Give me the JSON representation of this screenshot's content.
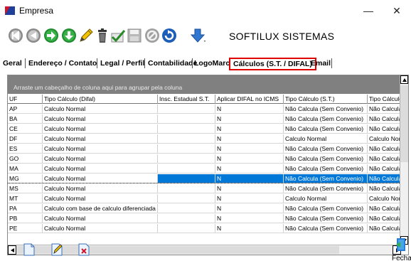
{
  "window": {
    "title": "Empresa",
    "minimize": "—",
    "close": "✕"
  },
  "toolbar": {
    "brand": "SOFTILUX SISTEMAS",
    "icons": [
      "first-record-icon",
      "previous-record-icon",
      "next-record-icon",
      "last-record-icon",
      "edit-icon",
      "delete-icon",
      "confirm-icon",
      "save-icon",
      "cancel-icon",
      "refresh-icon",
      "dropdown-arrow-icon"
    ]
  },
  "tabs": [
    "Geral",
    "Endereço / Contato",
    "Legal / Perfil",
    "Contabilidade",
    "LogoMarca",
    "Cálculos (S.T. / DIFAL)",
    "Email"
  ],
  "grid": {
    "group_hint": "Arraste um cabeçalho de coluna aqui para agrupar pela coluna",
    "columns": [
      "UF",
      "Tipo Cálculo (Difal)",
      "Insc. Estadual S.T.",
      "Aplicar DIFAL no ICMS",
      "Tipo Cálculo (S.T.)",
      "Tipo Cálculo"
    ],
    "rows": [
      [
        "AP",
        "Calculo Normal",
        "",
        "N",
        "Não Calcula (Sem Convenio)",
        "Não Calcula"
      ],
      [
        "BA",
        "Calculo Normal",
        "",
        "N",
        "Não Calcula (Sem Convenio)",
        "Não Calcula"
      ],
      [
        "CE",
        "Calculo Normal",
        "",
        "N",
        "Não Calcula (Sem Convenio)",
        "Não Calcula"
      ],
      [
        "DF",
        "Calculo Normal",
        "",
        "N",
        "Calculo Normal",
        "Calculo Norm"
      ],
      [
        "ES",
        "Calculo Normal",
        "",
        "N",
        "Não Calcula (Sem Convenio)",
        "Não Calcula"
      ],
      [
        "GO",
        "Calculo Normal",
        "",
        "N",
        "Não Calcula (Sem Convenio)",
        "Não Calcula"
      ],
      [
        "MA",
        "Calculo Normal",
        "",
        "N",
        "Não Calcula (Sem Convenio)",
        "Não Calcula"
      ],
      [
        "MG",
        "Calculo Normal",
        "",
        "N",
        "Não Calcula (Sem Convenio)",
        "Não Calcula"
      ],
      [
        "MS",
        "Calculo Normal",
        "",
        "N",
        "Não Calcula (Sem Convenio)",
        "Não Calcula"
      ],
      [
        "MT",
        "Calculo Normal",
        "",
        "N",
        "Calculo Normal",
        "Calculo Norm"
      ],
      [
        "PA",
        "Calculo com base de calculo diferenciada",
        "",
        "N",
        "Não Calcula (Sem Convenio)",
        "Não Calcula"
      ],
      [
        "PB",
        "Calculo Normal",
        "",
        "N",
        "Não Calcula (Sem Convenio)",
        "Não Calcula"
      ],
      [
        "PE",
        "Calculo Normal",
        "",
        "N",
        "Não Calcula (Sem Convenio)",
        "Não Calcula"
      ]
    ],
    "selected_row": 7
  },
  "footer": {
    "close_label": "Fechar"
  },
  "colors": {
    "selection": "#0078d7",
    "group_panel": "#808080",
    "active_tab_border": "#e00000"
  }
}
